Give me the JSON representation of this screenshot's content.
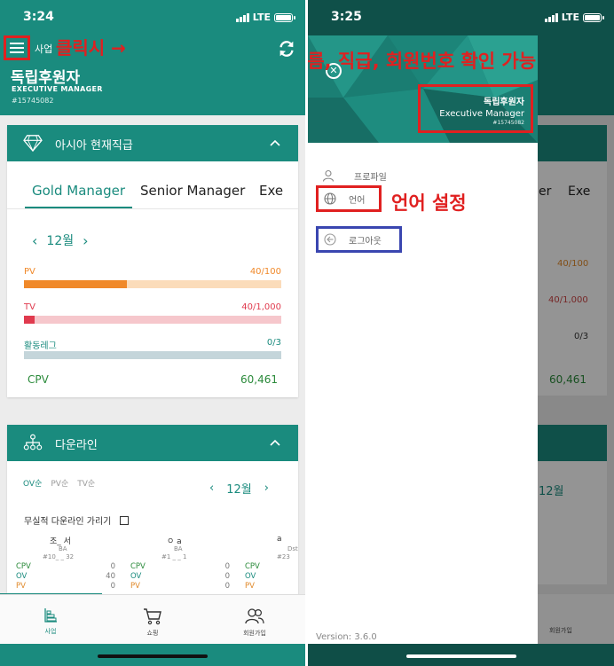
{
  "left": {
    "status": {
      "time": "3:24",
      "network": "LTE"
    },
    "header": {
      "label": "사업",
      "annotation": "클릭시 →",
      "name": "독립후원자",
      "title": "EXECUTIVE MANAGER",
      "id": "#15745082"
    },
    "rank_card": {
      "title": "아시아 현재직급",
      "tabs": [
        "Gold Manager",
        "Senior Manager",
        "Exe"
      ],
      "month": "12월",
      "metrics": [
        {
          "label": "PV",
          "value": "40/100",
          "progress": 0.4,
          "color": "#f0892a",
          "track": "#fbdcba"
        },
        {
          "label": "TV",
          "value": "40/1,000",
          "progress": 0.04,
          "color": "#e03a4e",
          "track": "#f6c7cc"
        },
        {
          "label": "활동레그",
          "value": "0/3",
          "progress": 0,
          "color": "#1a8b7e",
          "track": "#c4d5da"
        }
      ],
      "cpv_label": "CPV",
      "cpv_value": "60,461"
    },
    "down_card": {
      "title": "다운라인",
      "sort": [
        "OV순",
        "PV순",
        "TV순"
      ],
      "month": "12월",
      "hide_label": "무실적 다운라인 가리기",
      "nodes": [
        {
          "name": "조_ 서",
          "rank": "BA",
          "id": "#10_ _ 32",
          "cpv": "0",
          "ov": "40",
          "pv": "0"
        },
        {
          "name": "ㅇ a",
          "rank": "BA",
          "id": "#1 _ _ 1",
          "cpv": "0",
          "ov": "0",
          "pv": "0"
        },
        {
          "name": "a",
          "rank": "Dst",
          "id": "#23",
          "cpv": "",
          "ov": "",
          "pv": ""
        }
      ],
      "stat_labels": {
        "cpv": "CPV",
        "ov": "OV",
        "pv": "PV"
      }
    },
    "tabbar": [
      {
        "label": "사업",
        "icon": "business-icon"
      },
      {
        "label": "쇼핑",
        "icon": "cart-icon"
      },
      {
        "label": "회원가입",
        "icon": "users-icon"
      }
    ]
  },
  "right": {
    "status": {
      "time": "3:25",
      "network": "LTE"
    },
    "annotation_info": "이름, 직급, 회원번호 확인 가능",
    "user": {
      "name": "독립후원자",
      "title": "Executive Manager",
      "id": "#15745082"
    },
    "menu": {
      "profile": "프로파일",
      "language": "언어",
      "logout": "로그아웃"
    },
    "annotation_lang": "언어 설정",
    "version": "Version: 3.6.0",
    "background": {
      "tab_fragment": "er",
      "tab_fragment2": "Exe",
      "pv_value": "40/100",
      "tv_value": "40/1,000",
      "leg_value": "0/3",
      "cpv_value": "60,461",
      "month": "12월",
      "tab_label": "회원가입"
    }
  }
}
